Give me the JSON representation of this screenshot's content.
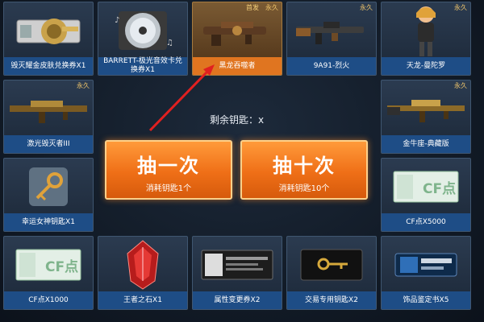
{
  "items": [
    {
      "label": "毁灭耀金皮肤兑换券X1",
      "badge": ""
    },
    {
      "label": "BARRETT-极光音效卡兑换券X1",
      "badge": ""
    },
    {
      "label": "黑龙吞噬者",
      "badge": "永久",
      "badge2": "首发"
    },
    {
      "label": "9A91-烈火",
      "badge": "永久"
    },
    {
      "label": "天龙-曼陀罗",
      "badge": "永久"
    },
    {
      "label": "激光毁灭者III",
      "badge": "永久"
    },
    {
      "label": "金牛座-典藏版",
      "badge": "永久"
    },
    {
      "label": "幸运女神钥匙X1",
      "badge": ""
    },
    {
      "label": "CF点X5000",
      "badge": ""
    },
    {
      "label": "CF点X1000",
      "badge": ""
    },
    {
      "label": "王者之石X1",
      "badge": ""
    },
    {
      "label": "属性变更券X2",
      "badge": ""
    },
    {
      "label": "交易专用钥匙X2",
      "badge": ""
    },
    {
      "label": "饰品鉴定书X5",
      "badge": ""
    }
  ],
  "remaining": "剩余钥匙：x",
  "draw_once": {
    "title": "抽一次",
    "cost": "消耗钥匙1个"
  },
  "draw_ten": {
    "title": "抽十次",
    "cost": "消耗钥匙10个"
  },
  "cf_card_text": "CF点",
  "colors": {
    "label_bg": "#1e4d86",
    "highlight_label": "#e07520",
    "button": "#ef6f17"
  }
}
